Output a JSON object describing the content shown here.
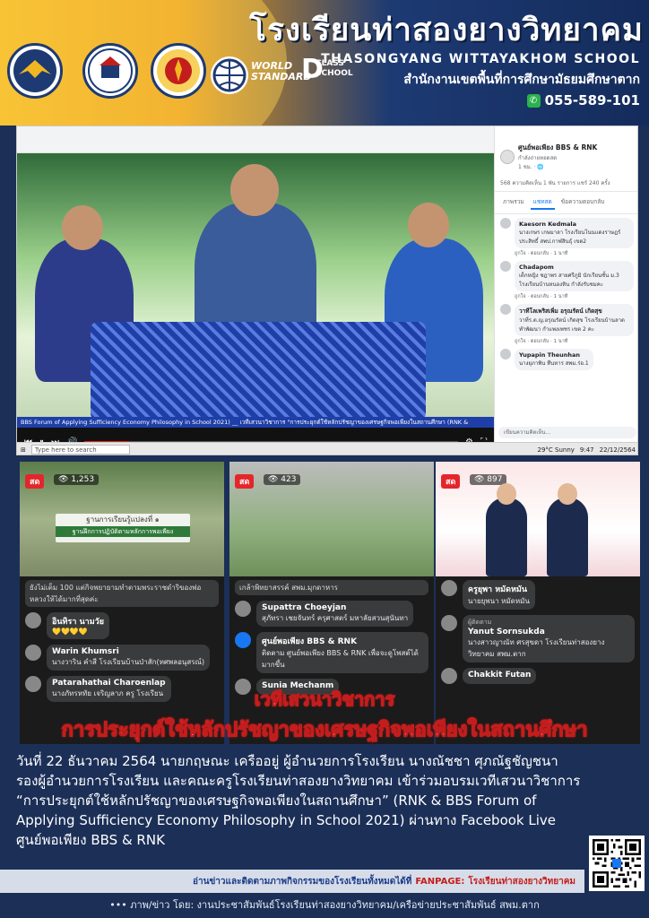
{
  "header": {
    "school_name_th": "โรงเรียนท่าสองยางวิทยาคม",
    "school_name_en": "THASONGYANG WITTAYAKHOM SCHOOL",
    "office": "สำนักงานเขตพื้นที่การศึกษามัธยมศึกษาตาก",
    "phone": "055-589-101",
    "world_class_line1": "WORLD",
    "world_class_line2": "STANDARD",
    "world_class_letter": "D",
    "world_class_line3": "CLASS",
    "world_class_line4": "SCHOOL"
  },
  "screenshot": {
    "video_caption": "BBS Forum of Applying Sufficiency Economy Philosophy in School 2021) __ เวทีเสวนาวิชาการ \"การประยุกต์ใช้หลักปรัชญาของเศรษฐกิจพอเพียงในสถานศึกษา (RNK &",
    "taskbar_search": "Type here to search",
    "weather": "29°C Sunny",
    "clock_time": "9:47",
    "clock_date": "22/12/2564",
    "fb": {
      "page_name": "ศูนย์พอเพียง BBS & RNK",
      "page_sub": "กำลังถ่ายทอดสด",
      "page_meta": "1 ชม. · 🌐",
      "stats": "568 ความคิดเห็น 1 พัน รายการ แชร์ 240 ครั้ง",
      "tabs": [
        "ภาพรวม",
        "แชทสด",
        "ข้อความตอบกลับ"
      ],
      "comments": [
        {
          "name": "Kaesorn Kedmala",
          "text": "นางเกษร เกษมาลา โรงเรียนโนนแดงราษฎร์ประสิทธิ์ สพป.กาฬสินธุ์ เขต2"
        },
        {
          "name": "Chadapom",
          "text": "เด็กหญิง ชฎาพร สายศรีภูมิ นักเรียนชั้น ม.3 โรงเรียนบ้านหนองหิน กำลังรับชมคะ"
        },
        {
          "name": "วาทีโลเพริสเพิ่ม อรุณรัตน์ เกิดสุข",
          "text": "วาที่ร.ต.ญ.อรุณรัตน์ เกิดสุข โรงเรียนบ้านลาดทำพัฒนา กำแพงเพชร เขต 2 คะ"
        },
        {
          "name": "Yupapin Theunhan",
          "text": "นางยุภาพิน ทืนหาร สพม.ร่อ.1"
        }
      ],
      "action_text": "ถูกใจ · ตอบกลับ · 1 นาที",
      "write_placeholder": "เขียนความคิดเห็น..."
    }
  },
  "panels": [
    {
      "live": "สด",
      "views": "1,253",
      "board_title": "ฐานการเรียนรู้แปลงที่ ๑",
      "board_sub": "ฐานฝึกการปฏิบัติตามหลักการพอเพียง",
      "pre": "ยังไม่เต็ม 100 แต่กิจพยายามทำตามพระราชดำริของพ่อหลวงให้ได้มากที่สุดค่ะ",
      "comments": [
        {
          "name": "อินทิรา นามวัย",
          "text": "💛💛💛💛"
        },
        {
          "name": "Warin Khumsri",
          "text": "นางวาริน คำสี โรงเรียนบ้านป่าสัก(ทศพลอนุสรณ์)"
        },
        {
          "name": "Patarahathai Charoenlap",
          "text": "นางภัทรหทัย เจริญลาภ ครู โรงเรียน"
        }
      ]
    },
    {
      "live": "สด",
      "views": "423",
      "pre": "เกล้าพิทยาสรรค์ สพม.มุกดาหาร",
      "comments": [
        {
          "name": "Supattra Choeyjan",
          "text": "สุภัทรา เชยจันทร์ ครุศาสตร์ มหาลัยสวนสุนันทา"
        },
        {
          "name": "ศูนย์พอเพียง BBS & RNK",
          "text": "ติดตาม ศูนย์พอเพียง BBS & RNK เพื่อจะดูโพสต์ได้มากขึ้น"
        },
        {
          "name": "Sunia Mechanm",
          "text": ""
        }
      ]
    },
    {
      "live": "สด",
      "views": "897",
      "comments": [
        {
          "name": "ครูยุพา หมัดหมัน",
          "text": "นายยุพนา หมัดหมัน"
        },
        {
          "name": "Yanut Sornsukda",
          "text": "นางสาวญาณัท ศรสุขดา โรงเรียนท่าสองยางวิทยาคม สพม.ตาก"
        },
        {
          "name": "Chakkit Futan",
          "text": ""
        }
      ],
      "ph_label": "ผู้ติดตาม"
    }
  ],
  "headline_1": "เวทีเสวนาวิชาการ",
  "headline_2": "การประยุกต์ใช้หลักปรัชญาของเศรษฐกิจพอเพียงในสถานศึกษา",
  "body": [
    "วันที่ 22 ธันวาคม 2564 นายกฤษณะ เครืออยู่ ผู้อำนวยการโรงเรียน นางณัชชา ศุภณัฐชัญชนา",
    "รองผู้อำนวยการโรงเรียน และคณะครูโรงเรียนท่าสองยางวิทยาคม เข้าร่วมอบรมเวทีเสวนาวิชาการ",
    "“การประยุกต์ใช้หลักปรัชญาของเศรษฐกิจพอเพียงในสถานศึกษา” (RNK & BBS Forum  of",
    "Applying Sufficiency Economy Philosophy in School 2021) ผ่านทาง Facebook Live",
    "ศูนย์พอเพียง BBS & RNK"
  ],
  "footer": {
    "fanpage_text": "อ่านข่าวและติดตามภาพกิจกรรมของโรงเรียนทั้งหมดได้ที่",
    "fanpage_label": "FANPAGE:",
    "fanpage_name": "โรงเรียนท่าสองยางวิทยาคม",
    "credit": "••• ภาพ/ข่าว โดย: งานประชาสัมพันธ์โรงเรียนท่าสองยางวิทยาคม/เครือข่ายประชาสัมพันธ์ สพม.ตาก"
  },
  "colors": {
    "navy": "#1b2f57",
    "gold": "#f2b720",
    "headline_stroke": "#c41d1d",
    "fb_blue": "#1877f2",
    "live_red": "#e4262b"
  }
}
